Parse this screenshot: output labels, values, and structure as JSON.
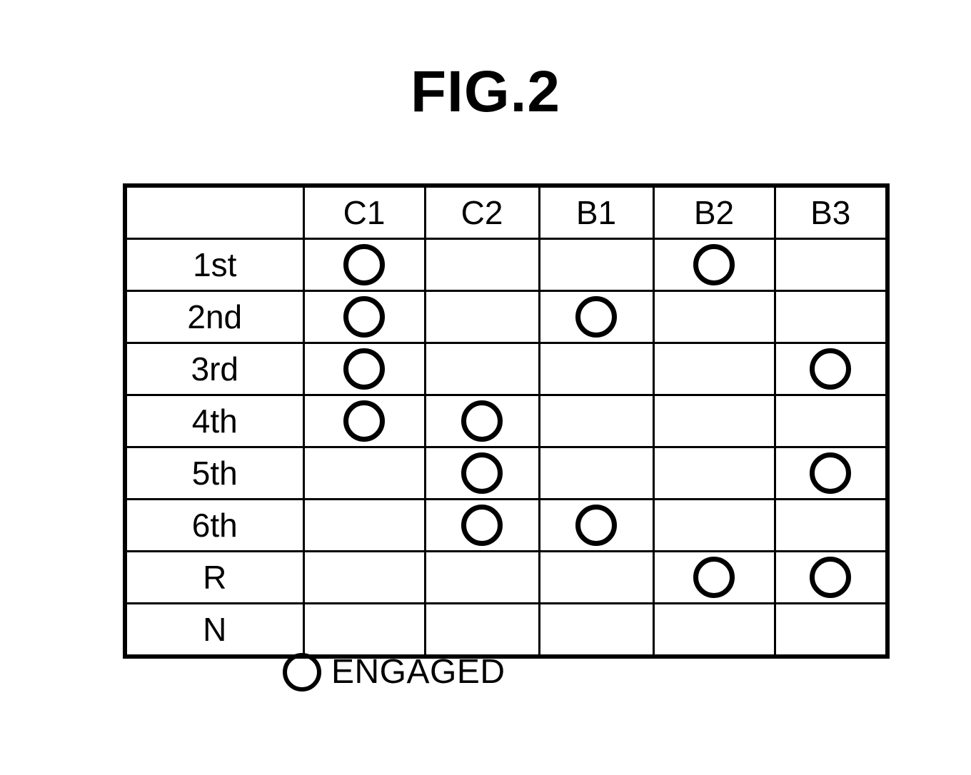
{
  "figure": {
    "title": "FIG.2"
  },
  "table": {
    "corner_label": "",
    "columns": [
      "C1",
      "C2",
      "B1",
      "B2",
      "B3"
    ],
    "rows": [
      {
        "label": "1st",
        "engaged": [
          true,
          false,
          false,
          true,
          false
        ]
      },
      {
        "label": "2nd",
        "engaged": [
          true,
          false,
          true,
          false,
          false
        ]
      },
      {
        "label": "3rd",
        "engaged": [
          true,
          false,
          false,
          false,
          true
        ]
      },
      {
        "label": "4th",
        "engaged": [
          true,
          true,
          false,
          false,
          false
        ]
      },
      {
        "label": "5th",
        "engaged": [
          false,
          true,
          false,
          false,
          true
        ]
      },
      {
        "label": "6th",
        "engaged": [
          false,
          true,
          true,
          false,
          false
        ]
      },
      {
        "label": "R",
        "engaged": [
          false,
          false,
          false,
          true,
          true
        ]
      },
      {
        "label": "N",
        "engaged": [
          false,
          false,
          false,
          false,
          false
        ]
      }
    ]
  },
  "legend": {
    "symbol": "circle-icon",
    "label": "ENGAGED"
  },
  "colors": {
    "ink": "#000000",
    "paper": "#ffffff"
  }
}
